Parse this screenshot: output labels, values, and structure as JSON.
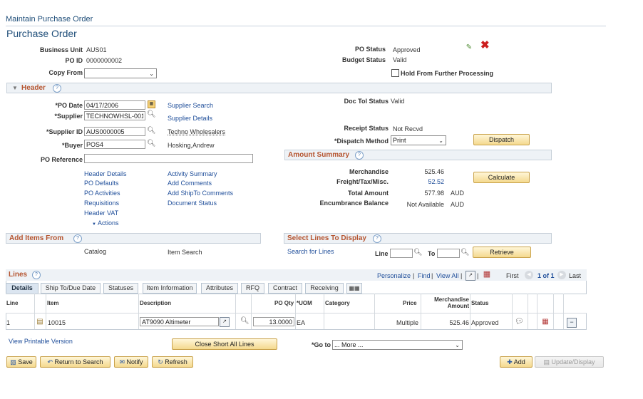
{
  "breadcrumb": "Maintain Purchase Order",
  "page_title": "Purchase Order",
  "header_fields": {
    "business_unit_label": "Business Unit",
    "business_unit": "AUS01",
    "po_id_label": "PO ID",
    "po_id": "0000000002",
    "copy_from_label": "Copy From",
    "copy_from": "",
    "po_status_label": "PO Status",
    "po_status": "Approved",
    "budget_status_label": "Budget Status",
    "budget_status": "Valid",
    "hold_label": "Hold From Further Processing"
  },
  "header_section": {
    "title": "Header",
    "po_date_label": "*PO Date",
    "po_date": "04/17/2006",
    "supplier_label": "*Supplier",
    "supplier": "TECHNOWHSL-001",
    "supplier_id_label": "*Supplier ID",
    "supplier_id": "AUS0000005",
    "buyer_label": "*Buyer",
    "buyer": "POS4",
    "po_reference_label": "PO Reference",
    "po_reference": "",
    "supplier_search": "Supplier Search",
    "supplier_details": "Supplier Details",
    "supplier_name": "Techno Wholesalers",
    "buyer_name": "Hosking,Andrew",
    "doc_tol_label": "Doc Tol Status",
    "doc_tol": "Valid",
    "receipt_status_label": "Receipt Status",
    "receipt_status": "Not Recvd",
    "dispatch_method_label": "*Dispatch Method",
    "dispatch_method": "Print",
    "dispatch_button": "Dispatch",
    "links_col1": [
      "Header Details",
      "PO Defaults",
      "PO Activities",
      "Requisitions",
      "Header VAT"
    ],
    "links_col2": [
      "Activity Summary",
      "Add Comments",
      "Add ShipTo Comments",
      "Document Status"
    ],
    "actions": "Actions"
  },
  "amount_summary": {
    "title": "Amount Summary",
    "merchandise_label": "Merchandise",
    "merchandise": "525.46",
    "freight_label": "Freight/Tax/Misc.",
    "freight": "52.52",
    "total_label": "Total Amount",
    "total": "577.98",
    "currency": "AUD",
    "encumbrance_label": "Encumbrance Balance",
    "encumbrance": "Not Available",
    "encumbrance_currency": "AUD",
    "calculate_button": "Calculate"
  },
  "add_items": {
    "title": "Add Items From",
    "catalog": "Catalog",
    "item_search": "Item Search"
  },
  "select_lines": {
    "title": "Select Lines To Display",
    "search_for_lines": "Search for Lines",
    "line_label": "Line",
    "to_label": "To",
    "retrieve_button": "Retrieve"
  },
  "lines": {
    "title": "Lines",
    "personalize": "Personalize",
    "find": "Find",
    "view_all": "View All",
    "first": "First",
    "range": "1 of 1",
    "last": "Last",
    "tabs": [
      "Details",
      "Ship To/Due Date",
      "Statuses",
      "Item Information",
      "Attributes",
      "RFQ",
      "Contract",
      "Receiving"
    ],
    "columns": [
      "Line",
      "Item",
      "Description",
      "PO Qty",
      "*UOM",
      "Category",
      "Price",
      "Merchandise Amount",
      "Status"
    ],
    "rows": [
      {
        "line": "1",
        "item": "10015",
        "description": "AT9090 Altimeter",
        "qty": "13.0000",
        "uom": "EA",
        "category": "",
        "price": "Multiple",
        "amount": "525.46",
        "status": "Approved"
      }
    ]
  },
  "footer": {
    "view_printable": "View Printable Version",
    "close_short": "Close Short All Lines",
    "goto_label": "*Go to",
    "goto_value": "... More ...",
    "save": "Save",
    "return_to_search": "Return to Search",
    "notify": "Notify",
    "refresh": "Refresh",
    "add": "Add",
    "update_display": "Update/Display"
  }
}
